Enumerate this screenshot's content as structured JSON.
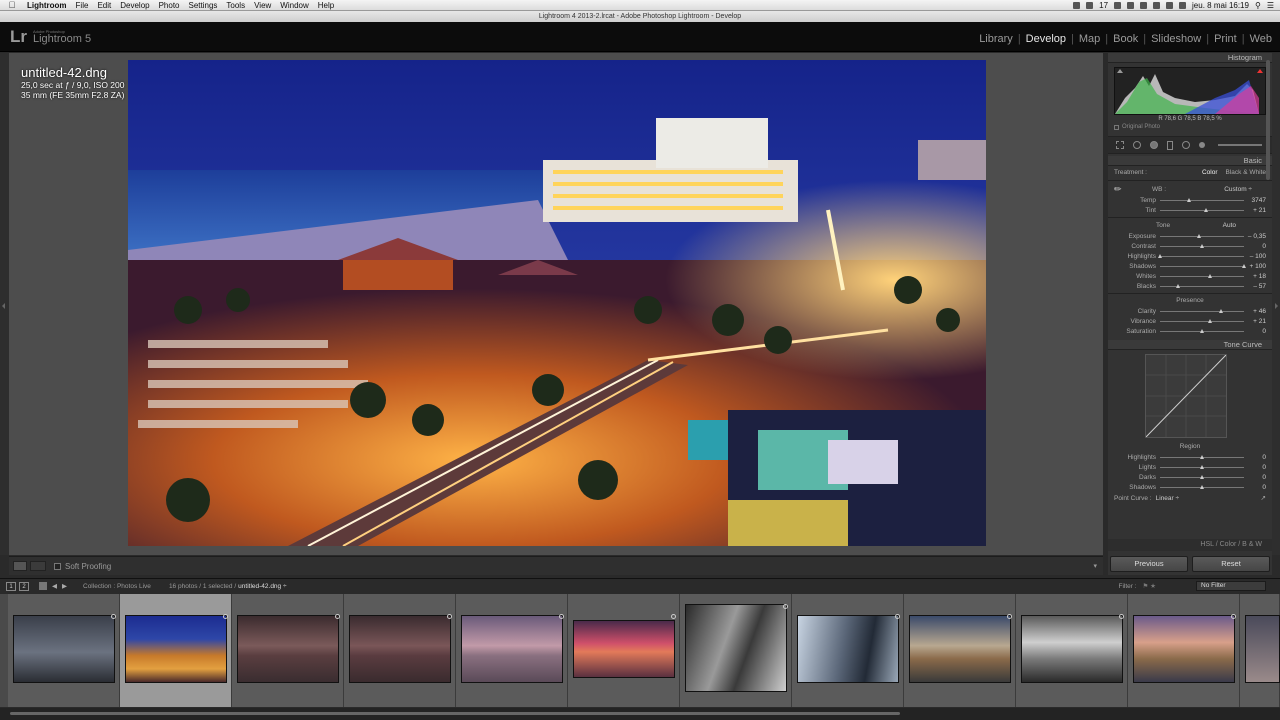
{
  "menubar": {
    "app": "Lightroom",
    "items": [
      "File",
      "Edit",
      "Develop",
      "Photo",
      "Settings",
      "Tools",
      "View",
      "Window",
      "Help"
    ],
    "status_num": "17",
    "clock": "jeu. 8 mai  16:19"
  },
  "window_title": "Lightroom 4 2013-2.lrcat - Adobe Photoshop Lightroom - Develop",
  "identity": {
    "logo": "Lr",
    "vendor": "Adobe Photoshop",
    "product": "Lightroom 5"
  },
  "modules": [
    {
      "label": "Library",
      "active": false
    },
    {
      "label": "Develop",
      "active": true
    },
    {
      "label": "Map",
      "active": false
    },
    {
      "label": "Book",
      "active": false
    },
    {
      "label": "Slideshow",
      "active": false
    },
    {
      "label": "Print",
      "active": false
    },
    {
      "label": "Web",
      "active": false
    }
  ],
  "photo_info": {
    "filename": "untitled-42.dng",
    "exposure": "25,0 sec at ƒ / 9,0, ISO 200",
    "lens": "35 mm (FE 35mm F2.8 ZA)"
  },
  "toolbar": {
    "soft_proofing": "Soft Proofing"
  },
  "right_panel": {
    "histogram_title": "Histogram",
    "hist_values": "R 78,6  G 78,5  B 78,5 %",
    "original_photo": "Original Photo",
    "basic_title": "Basic",
    "treatment_label": "Treatment :",
    "treatment_color": "Color",
    "treatment_bw": "Black & White",
    "wb_label": "WB :",
    "wb_value": "Custom ÷",
    "temp": {
      "label": "Temp",
      "value": "3747",
      "pos": 0.35
    },
    "tint": {
      "label": "Tint",
      "value": "+ 21",
      "pos": 0.55
    },
    "tone_label": "Tone",
    "auto_label": "Auto",
    "exposure": {
      "label": "Exposure",
      "value": "– 0,35",
      "pos": 0.47
    },
    "contrast": {
      "label": "Contrast",
      "value": "0",
      "pos": 0.5
    },
    "highlights": {
      "label": "Highlights",
      "value": "– 100",
      "pos": 0.0
    },
    "shadows": {
      "label": "Shadows",
      "value": "+ 100",
      "pos": 1.0
    },
    "whites": {
      "label": "Whites",
      "value": "+ 18",
      "pos": 0.59
    },
    "blacks": {
      "label": "Blacks",
      "value": "– 57",
      "pos": 0.21
    },
    "presence_label": "Presence",
    "clarity": {
      "label": "Clarity",
      "value": "+ 46",
      "pos": 0.73
    },
    "vibrance": {
      "label": "Vibrance",
      "value": "+ 21",
      "pos": 0.6
    },
    "saturation": {
      "label": "Saturation",
      "value": "0",
      "pos": 0.5
    },
    "tone_curve_title": "Tone Curve",
    "region_label": "Region",
    "r_highlights": {
      "label": "Highlights",
      "value": "0",
      "pos": 0.5
    },
    "r_lights": {
      "label": "Lights",
      "value": "0",
      "pos": 0.5
    },
    "r_darks": {
      "label": "Darks",
      "value": "0",
      "pos": 0.5
    },
    "r_shadows": {
      "label": "Shadows",
      "value": "0",
      "pos": 0.5
    },
    "point_curve_label": "Point Curve :",
    "point_curve_value": "Linear ÷",
    "hsl_header": "HSL  /  Color  /  B & W",
    "previous": "Previous",
    "reset": "Reset"
  },
  "filmstrip_bar": {
    "page1": "1",
    "page2": "2",
    "collection": "Collection : Photos Live",
    "count": "16 photos / 1 selected /",
    "filename": "untitled-42.dng ÷",
    "filter_label": "Filter :",
    "filter_value": "No Filter"
  },
  "colors": {
    "accent_active": "#e6e6e6",
    "panel_bg": "#333333",
    "photo_sky": "#1c2f8a"
  }
}
